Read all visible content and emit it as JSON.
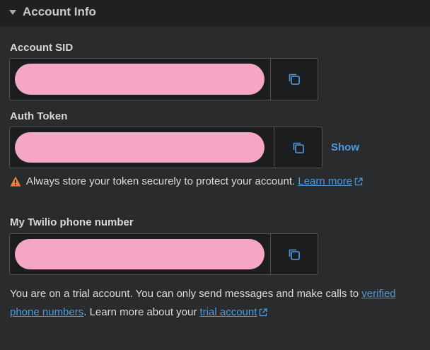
{
  "section": {
    "title": "Account Info"
  },
  "account_sid": {
    "label": "Account SID"
  },
  "auth_token": {
    "label": "Auth Token",
    "show_label": "Show",
    "warning_text": "Always store your token securely to protect your account.",
    "learn_more_label": "Learn more"
  },
  "phone_number": {
    "label": "My Twilio phone number"
  },
  "trial_notice": {
    "text_before": "You are on a trial account. You can only send messages and make calls to",
    "verified_link": "verified phone numbers",
    "text_middle": ". Learn more about your",
    "trial_link": "trial account"
  },
  "colors": {
    "accent": "#4e9be0",
    "mask": "#f5a6c4",
    "warning": "#f07f3c"
  },
  "icons": [
    "caret-down-icon",
    "copy-icon",
    "warning-icon",
    "external-link-icon"
  ]
}
